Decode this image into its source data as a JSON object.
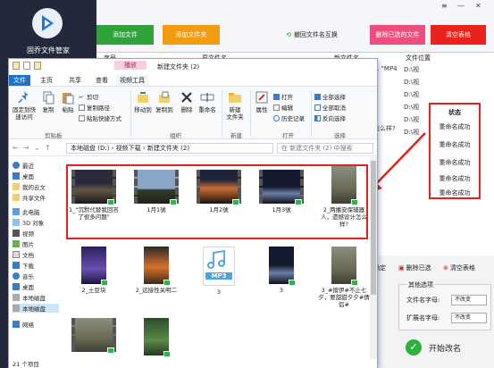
{
  "app": {
    "name": "固乔文件管家",
    "window_controls": [
      "≡",
      "—",
      "✕"
    ],
    "toolbar": {
      "add_file": "添加文件",
      "add_folder": "添加文件夹",
      "restore": "撤回文件名互换",
      "delete_selected": "删除已选的文件",
      "clear": "清空表格"
    },
    "table": {
      "col_seq": "序号",
      "col_orig": "原文件名",
      "col_new": "新文件名",
      "col_loc": "文件位置",
      "col_status": "状态",
      "new_name_fragment": "1 \"MP4",
      "new_name_question": "怎么样?",
      "loc_values": [
        "D:\\视",
        "D:\\视",
        "D:\\视",
        "D:\\视",
        "D:\\视",
        "D:\\视"
      ],
      "status_values": [
        "重命名成功",
        "重命名成功",
        "重命名成功",
        "重命名成功",
        "重命名成功"
      ]
    },
    "bottom": {
      "confirm": "确定",
      "delete_selected": "删除已选",
      "clear_table": "清空表格",
      "options_title": "其他选项",
      "name_case_label": "文件名字母:",
      "ext_case_label": "扩展名字母:",
      "name_case_value": "不改变",
      "ext_case_value": "不改变",
      "start": "开始改名"
    }
  },
  "explorer": {
    "context_tab": "播放",
    "title": "新建文件夹 (2)",
    "tabs": [
      "文件",
      "主页",
      "共享",
      "查看",
      "视频工具"
    ],
    "ribbon": {
      "pin": "固定到快\n速访问",
      "copy": "复制",
      "paste": "粘贴",
      "cut": "剪切",
      "copy_path": "复制路径",
      "paste_shortcut": "粘贴快捷方式",
      "move_to": "移动到",
      "copy_to": "复制到",
      "delete": "删除",
      "rename": "重命名",
      "new_folder": "新建\n文件夹",
      "properties": "属性",
      "open": "打开",
      "edit": "编辑",
      "history": "历史记录",
      "select_all": "全部选择",
      "select_none": "全部取消",
      "invert": "反向选择",
      "group_clipboard": "剪贴板",
      "group_organize": "组织",
      "group_new": "新建",
      "group_open": "打开",
      "group_select": "选择"
    },
    "address": "本地磁盘 (D:) › 视频下载 › 新建文件夹 (2)",
    "search_placeholder": "在 新建文件夹 (2) 中搜索",
    "nav": [
      "最近",
      "桌面",
      "我的云文",
      "共享文件",
      "此电脑",
      "3D 对象",
      "视频",
      "图片",
      "文档",
      "下载",
      "音乐",
      "桌面",
      "本地磁盘",
      "本地磁盘",
      "网络"
    ],
    "files": [
      {
        "label": "1_\"沉默代替我回答了很多问题\"",
        "kind": "video",
        "tone": "dusk"
      },
      {
        "label": "1月1號",
        "kind": "video",
        "tone": "sky"
      },
      {
        "label": "1月2號",
        "kind": "video",
        "tone": "sunset"
      },
      {
        "label": "1月3號",
        "kind": "video",
        "tone": "night"
      },
      {
        "label": "2_两播安保辅器人，遗憾设计怎么样?",
        "kind": "portrait",
        "tone": "street"
      },
      {
        "label": "2_土豆块",
        "kind": "portrait",
        "tone": "purple"
      },
      {
        "label": "2_远接性关明二",
        "kind": "portrait",
        "tone": "orange"
      },
      {
        "label": "3",
        "kind": "audio",
        "tone": "mp3"
      },
      {
        "label": "3",
        "kind": "portrait",
        "tone": "night"
      },
      {
        "label": "3_#擅伊#不止七夕，要甜甜夕夕#情侣#",
        "kind": "portrait",
        "tone": "street"
      },
      {
        "label": "",
        "kind": "video",
        "tone": "street"
      },
      {
        "label": "",
        "kind": "portrait",
        "tone": "green"
      }
    ],
    "audio_badge": "MP3",
    "status": "21 个项目"
  }
}
